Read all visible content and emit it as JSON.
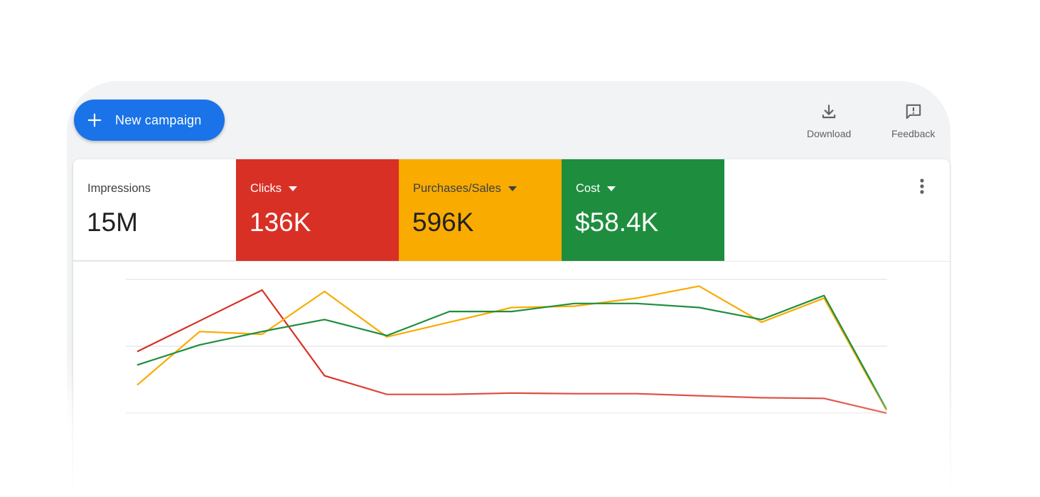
{
  "toolbar": {
    "new_campaign_label": "New campaign",
    "download_label": "Download",
    "feedback_label": "Feedback"
  },
  "icons": {
    "plus": "plus-icon",
    "download": "download-icon",
    "feedback": "feedback-icon",
    "more": "more-vert-icon",
    "caret": "arrow-drop-down-icon"
  },
  "metrics": [
    {
      "label": "Impressions",
      "value": "15M",
      "color": "#ffffff",
      "has_dropdown": false
    },
    {
      "label": "Clicks",
      "value": "136K",
      "color": "#d93025",
      "has_dropdown": true
    },
    {
      "label": "Purchases/Sales",
      "value": "596K",
      "color": "#f9ab00",
      "has_dropdown": true
    },
    {
      "label": "Cost",
      "value": "$58.4K",
      "color": "#1e8e3e",
      "has_dropdown": true
    }
  ],
  "colors": {
    "accent": "#1a73e8",
    "clicks": "#d93025",
    "purchases": "#f9ab00",
    "cost": "#1e8e3e"
  },
  "chart_data": {
    "type": "line",
    "x": [
      1,
      2,
      3,
      4,
      5,
      6,
      7,
      8,
      9,
      10,
      11,
      12,
      13
    ],
    "series": [
      {
        "color": "#d93025",
        "values": [
          0.46,
          0.69,
          0.92,
          0.28,
          0.14,
          0.14,
          0.15,
          0.145,
          0.145,
          0.13,
          0.115,
          0.11,
          0.0
        ]
      },
      {
        "color": "#f9ab00",
        "values": [
          0.21,
          0.61,
          0.59,
          0.91,
          0.57,
          0.68,
          0.79,
          0.8,
          0.86,
          0.95,
          0.68,
          0.86,
          0.02
        ]
      },
      {
        "color": "#1e8e3e",
        "values": [
          0.36,
          0.51,
          0.61,
          0.7,
          0.58,
          0.76,
          0.76,
          0.82,
          0.82,
          0.79,
          0.7,
          0.88,
          0.03
        ]
      }
    ],
    "ylim": [
      0,
      1
    ],
    "grid": true
  }
}
